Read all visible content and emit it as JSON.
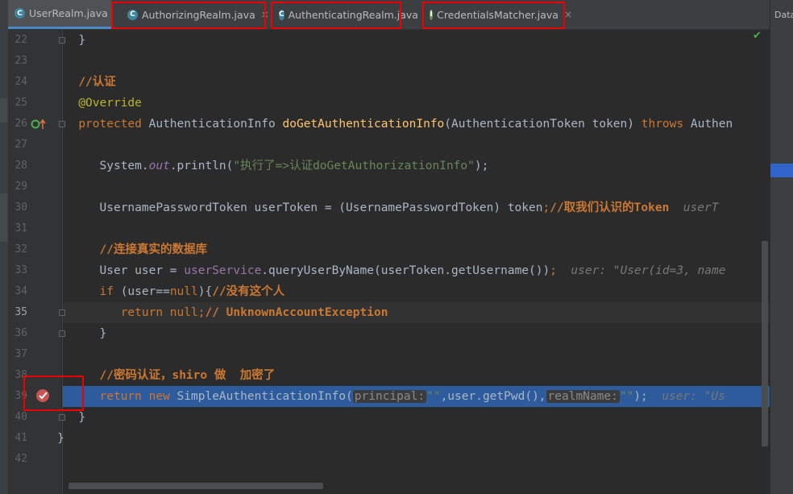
{
  "tabs": [
    {
      "label": "UserRealm.java",
      "icon": "C",
      "icon_color": "#3e86a0",
      "close": ""
    },
    {
      "label": "AuthorizingRealm.java",
      "icon": "C",
      "icon_color": "#3e86a0",
      "close": "×"
    },
    {
      "label": "AuthenticatingRealm.java",
      "icon": "C",
      "icon_color": "#3e86a0",
      "close": ""
    },
    {
      "label": "CredentialsMatcher.java",
      "icon": "I",
      "icon_color": "#6a9955",
      "close": "×"
    }
  ],
  "right_panel": {
    "label": "Data"
  },
  "status": {
    "check": "✔"
  },
  "lines": [
    "22",
    "23",
    "24",
    "25",
    "26",
    "27",
    "28",
    "29",
    "30",
    "31",
    "32",
    "33",
    "34",
    "35",
    "36",
    "37",
    "38",
    "39",
    "40",
    "41",
    "42"
  ],
  "code": {
    "l22_brace": "}",
    "l24_comment": "//认证",
    "l25_ann": "@Override",
    "l26_kw1": "protected",
    "l26_type": " AuthenticationInfo ",
    "l26_fn": "doGetAuthenticationInfo",
    "l26_params": "(AuthenticationToken token) ",
    "l26_kw2": "throws",
    "l26_tail": " Authen",
    "l28_a": "System.",
    "l28_out": "out",
    "l28_b": ".println(",
    "l28_str": "\"执行了=>认证doGetAuthorizationInfo\"",
    "l28_c": ");",
    "l30_a": "UsernamePasswordToken userToken = (UsernamePasswordToken) token",
    "l30_semi": ";",
    "l30_cmt": "//取我们认识的Token",
    "l30_hint": "  userT",
    "l32_cmt": "//连接真实的数据库",
    "l33_a": "User user = ",
    "l33_svc": "userService",
    "l33_b": ".queryUserByName(userToken.getUsername())",
    "l33_semi": ";",
    "l33_hint": "  user: \"User(id=3, name",
    "l34_kw": "if",
    "l34_a": " (user==",
    "l34_null": "null",
    "l34_b": "){",
    "l34_cmt": "//没有这个人",
    "l35_kw": "return",
    "l35_null": " null",
    "l35_semi": ";",
    "l35_cmt": "// UnknownAccountException",
    "l36_brace": "}",
    "l38_cmt": "//密码认证，shiro 做  加密了",
    "l39_kw1": "return",
    "l39_kw2": " new",
    "l39_a": " SimpleAuthenticationInfo(",
    "l39_h1": "principal:",
    "l39_s1": "\"\"",
    "l39_b": ",user.getPwd(),",
    "l39_h2": "realmName:",
    "l39_s2": "\"\"",
    "l39_c": ");",
    "l39_hint": "  user: \"Us",
    "l40_brace": "}",
    "l41_brace": "}"
  }
}
